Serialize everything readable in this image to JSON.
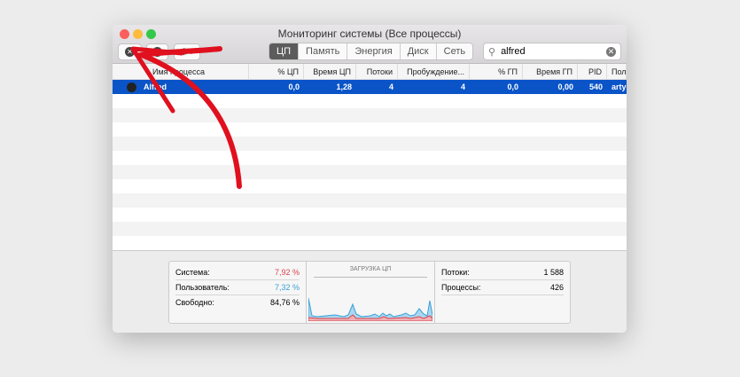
{
  "window": {
    "title": "Мониторинг системы (Все процессы)"
  },
  "toolbar": {
    "tabs": [
      "ЦП",
      "Память",
      "Энергия",
      "Диск",
      "Сеть"
    ],
    "active_tab": "ЦП",
    "search_value": "alfred",
    "gear_caret": "⌄"
  },
  "table": {
    "headers": [
      "Имя процесса",
      "% ЦП",
      "Время ЦП",
      "Потоки",
      "Пробуждение...",
      "% ГП",
      "Время ГП",
      "PID",
      "Пол"
    ],
    "rows": [
      {
        "name": "Alfred",
        "cpu": "0,0",
        "cpu_time": "1,28",
        "threads": "4",
        "wakeups": "4",
        "gpu": "0,0",
        "gpu_time": "0,00",
        "pid": "540",
        "user": "artyo"
      }
    ]
  },
  "stats": {
    "system_label": "Система:",
    "system_value": "7,92 %",
    "user_label": "Пользователь:",
    "user_value": "7,32 %",
    "idle_label": "Свободно:",
    "idle_value": "84,76 %",
    "chart_title": "ЗАГРУЗКА ЦП",
    "threads_label": "Потоки:",
    "threads_value": "1 588",
    "processes_label": "Процессы:",
    "processes_value": "426"
  },
  "colors": {
    "system": "#d9434e",
    "user": "#3a9fd6",
    "selection": "#0a54c8",
    "annotation": "#e0101e"
  }
}
